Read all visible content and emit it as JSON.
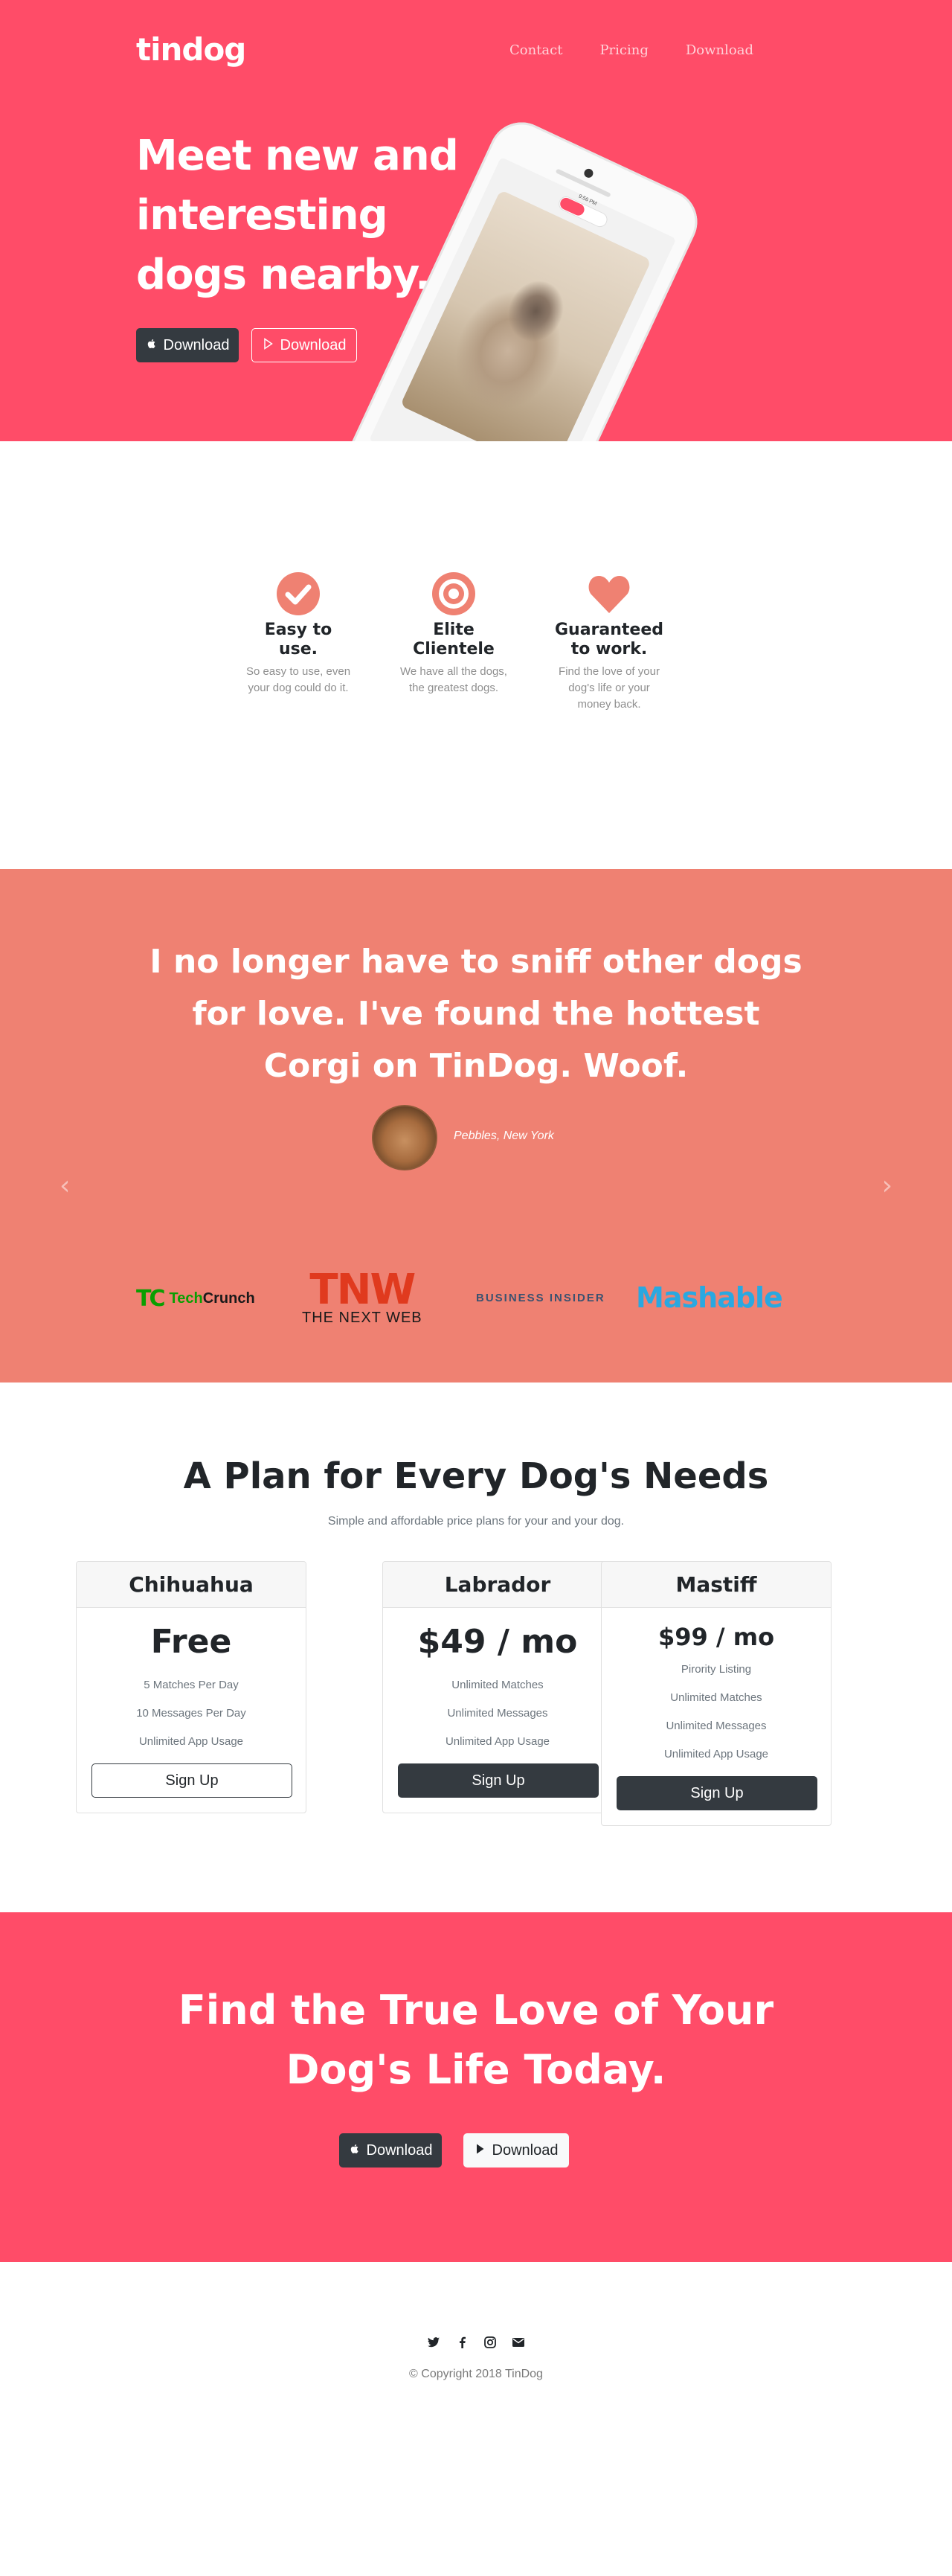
{
  "brand": "tindog",
  "nav": {
    "contact": "Contact",
    "pricing": "Pricing",
    "download": "Download"
  },
  "hero": {
    "title": "Meet new and interesting dogs nearby.",
    "apple_button": "Download",
    "play_button": "Download",
    "phone_time": "9:56 PM"
  },
  "features": [
    {
      "title": "Easy to use.",
      "text": "So easy to use, even your dog could do it.",
      "icon": "check-circle-icon"
    },
    {
      "title": "Elite Clientele",
      "text": "We have all the dogs, the greatest dogs.",
      "icon": "bullseye-icon"
    },
    {
      "title": "Guaranteed to work.",
      "text": "Find the love of your dog's life or your money back.",
      "icon": "heart-icon"
    }
  ],
  "testimonial": {
    "quote": "I no longer have to sniff other dogs for love. I've found the hottest Corgi on TinDog. Woof.",
    "author": "Pebbles, New York"
  },
  "press": {
    "techcrunch_prefix": "Tech",
    "techcrunch_word": "Crunch",
    "tnw_big": "TNW",
    "tnw_small": "THE NEXT WEB",
    "business_insider": "BUSINESS INSIDER",
    "mashable": "Mashable"
  },
  "pricing": {
    "title": "A Plan for Every Dog's Needs",
    "subtitle": "Simple and affordable price plans for your and your dog.",
    "plans": [
      {
        "name": "Chihuahua",
        "price": "Free",
        "features": [
          "5 Matches Per Day",
          "10 Messages Per Day",
          "Unlimited App Usage"
        ],
        "button": "Sign Up"
      },
      {
        "name": "Labrador",
        "price": "$49 / mo",
        "features": [
          "Unlimited Matches",
          "Unlimited Messages",
          "Unlimited App Usage"
        ],
        "button": "Sign Up"
      },
      {
        "name": "Mastiff",
        "price": "$99 / mo",
        "features": [
          "Pirority Listing",
          "Unlimited Matches",
          "Unlimited Messages",
          "Unlimited App Usage"
        ],
        "button": "Sign Up"
      }
    ]
  },
  "cta": {
    "title": "Find the True Love of Your Dog's Life Today.",
    "apple_button": "Download",
    "play_button": "Download"
  },
  "footer": {
    "copyright": "© Copyright 2018 TinDog"
  },
  "colors": {
    "primary": "#ff4c68",
    "testimonial_bg": "#ef8172",
    "dark": "#343a40"
  }
}
